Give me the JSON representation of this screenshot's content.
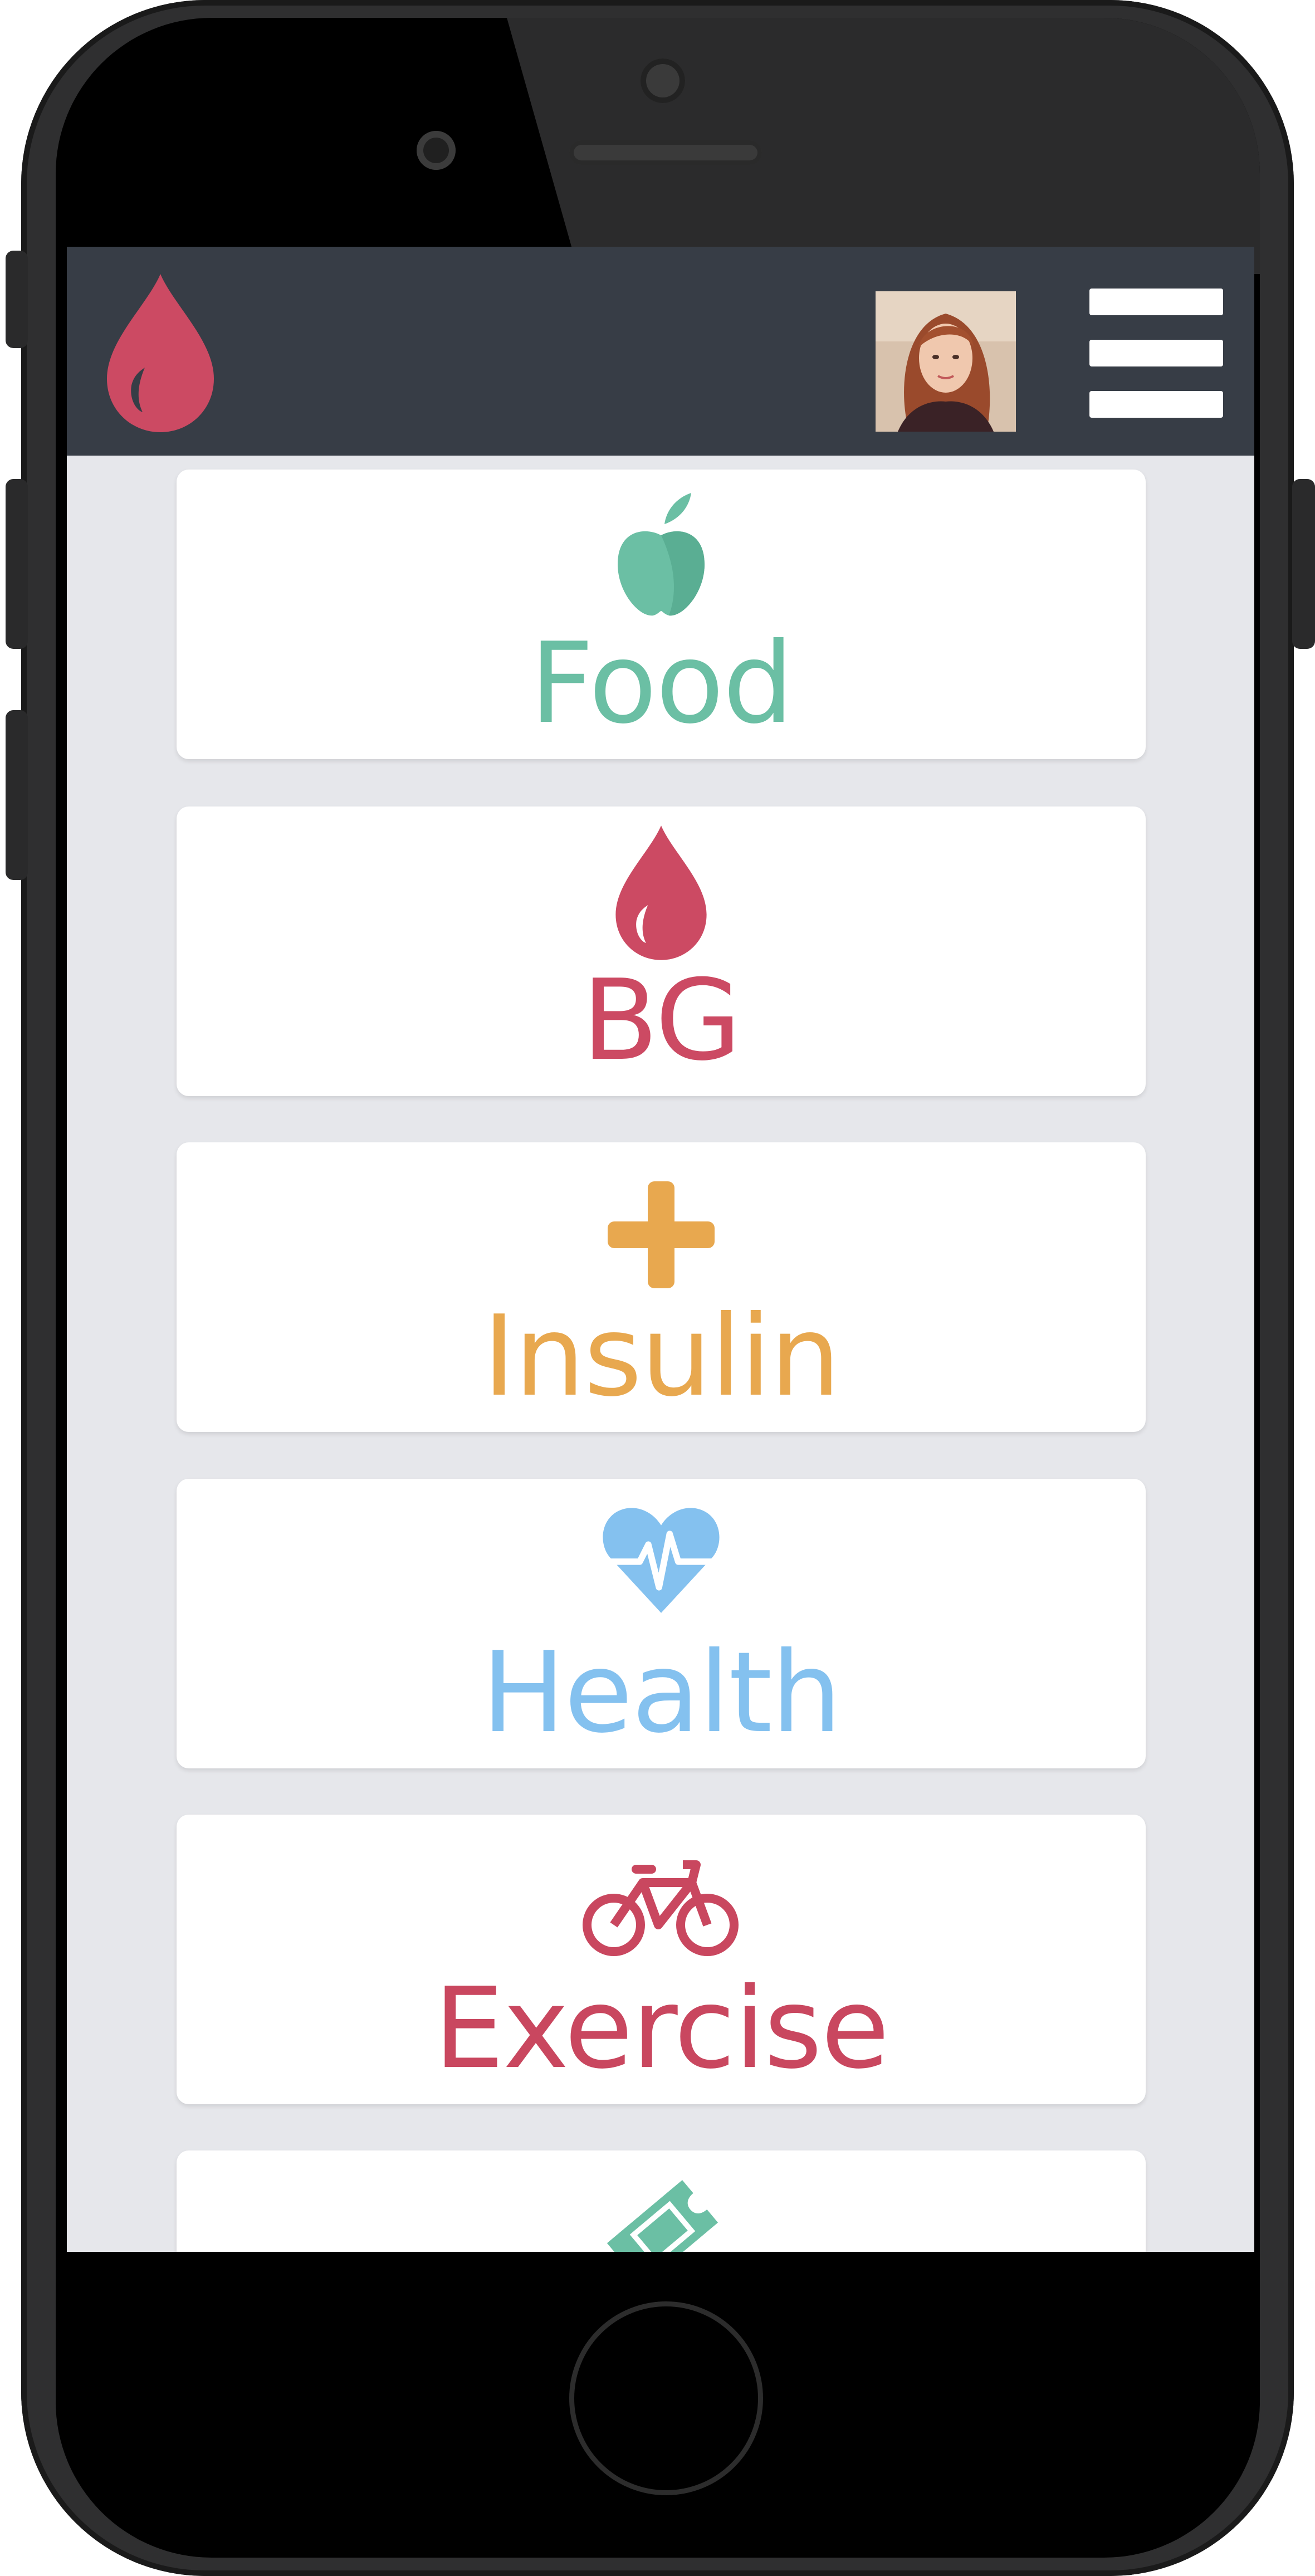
{
  "app": {
    "logo_icon": "blood-drop-icon",
    "menu_icon": "hamburger-menu-icon",
    "colors": {
      "header": "#373d46",
      "brand": "#cc4a63",
      "screen_bg": "#e6e7eb"
    }
  },
  "categories": [
    {
      "label": "Food",
      "icon": "apple-icon",
      "color": "#6bbfa4"
    },
    {
      "label": "BG",
      "icon": "blood-drop-icon",
      "color": "#cc4a63"
    },
    {
      "label": "Insulin",
      "icon": "plus-icon",
      "color": "#e8a84f"
    },
    {
      "label": "Health",
      "icon": "heartbeat-icon",
      "color": "#84c1ef"
    },
    {
      "label": "Exercise",
      "icon": "bicycle-icon",
      "color": "#c9475f"
    },
    {
      "label": "",
      "icon": "ticket-icon",
      "color": "#6bbfa4"
    }
  ]
}
